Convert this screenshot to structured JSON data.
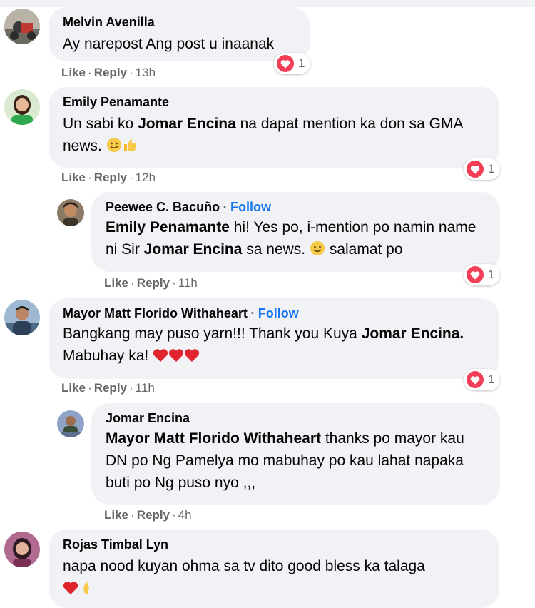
{
  "comments": [
    {
      "name": "Melvin Avenilla",
      "text": "Ay narepost Ang post u inaanak",
      "time": "13h",
      "reactions": "1"
    },
    {
      "name": "Emily Penamante",
      "text_before": "Un sabi ko ",
      "mention": "Jomar Encina",
      "text_after": " na dapat mention ka don sa GMA news.",
      "time": "12h",
      "reactions": "1"
    },
    {
      "name": "Peewee C. Bacuño",
      "follow": "Follow",
      "mention1": "Emily Penamante",
      "text1": " hi! Yes po, i-mention po namin name ni Sir ",
      "mention2": "Jomar Encina",
      "text2": " sa news.",
      "text3": " salamat po",
      "time": "11h",
      "reactions": "1"
    },
    {
      "name": "Mayor Matt Florido Withaheart",
      "follow": "Follow",
      "text_before": "Bangkang may puso yarn!!! Thank you Kuya ",
      "mention": "Jomar Encina.",
      "text_after": " Mabuhay ka!",
      "time": "11h",
      "reactions": "1"
    },
    {
      "name": "Jomar Encina",
      "mention": "Mayor Matt Florido Withaheart",
      "text_after": " thanks po mayor kau DN po Ng Pamelya mo mabuhay po kau lahat napaka buti po Ng puso nyo ,,,",
      "time": "4h"
    },
    {
      "name": "Rojas Timbal Lyn",
      "text": "napa nood kuyan ohma sa tv dito good bless ka talaga"
    }
  ],
  "labels": {
    "like": "Like",
    "reply": "Reply",
    "dot": "·"
  },
  "colors": {
    "heart": "#f33e58",
    "link": "#1877f2",
    "bubble": "#f0f2f5"
  }
}
